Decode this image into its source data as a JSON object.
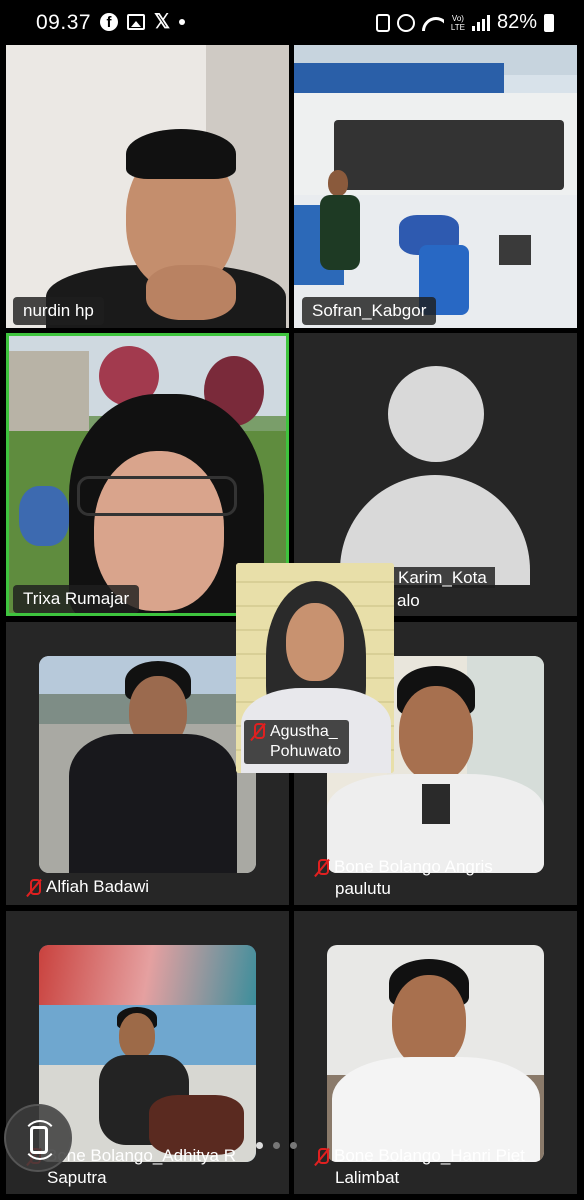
{
  "status_bar": {
    "time": "09.37",
    "battery": "82%",
    "volte": "Vo) LTE"
  },
  "tiles": [
    {
      "id": "nurdin",
      "name": "nurdin hp",
      "muted": false
    },
    {
      "id": "sofran",
      "name": "Sofran_Kabgor",
      "muted": false
    },
    {
      "id": "trixa",
      "name": "Trixa Rumajar",
      "muted": false,
      "active_speaker": true
    },
    {
      "id": "karim",
      "name_line1": "Karim_Kota",
      "name_line2": "alo",
      "muted": false
    },
    {
      "id": "alfiah",
      "name": "Alfiah Badawi",
      "muted": true
    },
    {
      "id": "angris",
      "name_line1": "Bone Bolango Angris",
      "name_line2": "paulutu",
      "muted": true
    },
    {
      "id": "adhitya",
      "name_line1": "Bone Bolango_Adhitya R",
      "name_line2": "Saputra",
      "muted": true
    },
    {
      "id": "hanri",
      "name_line1": "Bone Bolango_Hanri Piet",
      "name_line2": "Lalimbat",
      "muted": true
    }
  ],
  "self_view": {
    "name_line1": "Agustha_",
    "name_line2": "Pohuwato",
    "muted": true
  },
  "pager": {
    "current_page": 1,
    "total_pages": 3
  },
  "colors": {
    "active_speaker_border": "#3ec43e",
    "muted_mic": "#e02020",
    "tile_bg": "#1a1a1a"
  }
}
